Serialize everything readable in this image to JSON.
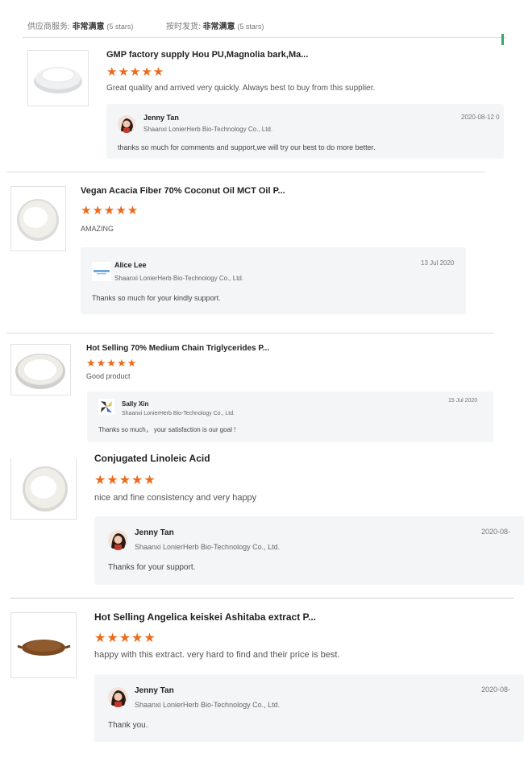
{
  "topbar": {
    "service_label": "供应商服务:",
    "service_value": "非常满意",
    "service_stars": "(5 stars)",
    "delivery_label": "按时发货:",
    "delivery_value": "非常满意",
    "delivery_stars": "(5 stars)"
  },
  "colors": {
    "star": "#ee6a1a",
    "reply_bg": "#f4f5f6",
    "divider": "#dcdcdc"
  },
  "reviews": [
    {
      "product_title": "GMP factory supply Hou PU,Magnolia bark,Ma...",
      "rating": 5,
      "stars": "★★★★★",
      "comment": "Great quality and arrived very quickly.  Always best to buy from this supplier.",
      "thumb_icon": "white-powder-dish-icon",
      "reply": {
        "name": "Jenny Tan",
        "company": "Shaanxi LonierHerb Bio-Technology Co., Ltd.",
        "date": "2020-08-12 0",
        "text": "thanks so much for comments and support,we will try our best to do more better.",
        "avatar_icon": "jenny-tan-avatar-icon"
      }
    },
    {
      "product_title": "Vegan Acacia Fiber 70% Coconut Oil MCT Oil P...",
      "rating": 5,
      "stars": "★★★★★",
      "comment": "AMAZING",
      "thumb_icon": "white-powder-dish-icon",
      "reply": {
        "name": "Alice Lee",
        "company": "Shaanxi LonierHerb Bio-Technology Co., Ltd.",
        "date": "13 Jul 2020",
        "text": "Thanks so much for your kindly support.",
        "avatar_icon": "company-logo-avatar-icon"
      }
    },
    {
      "product_title": "Hot Selling 70% Medium Chain Triglycerides P...",
      "rating": 5,
      "stars": "★★★★★",
      "comment": "Good product",
      "thumb_icon": "white-powder-dish-icon",
      "reply": {
        "name": "Sally Xin",
        "company": "Shaanxi LonierHerb Bio-Technology Co., Ltd.",
        "date": "15 Jul 2020",
        "text": "Thanks so much， your satisfaction is our goal !",
        "avatar_icon": "pinwheel-avatar-icon"
      }
    },
    {
      "product_title": "Conjugated Linoleic Acid",
      "rating": 5,
      "stars": "★★★★★",
      "comment": "nice and fine consistency and very happy",
      "thumb_icon": "white-powder-dish-icon",
      "reply": {
        "name": "Jenny Tan",
        "company": "Shaanxi LonierHerb Bio-Technology Co., Ltd.",
        "date": "2020-08-",
        "text": "Thanks for your support.",
        "avatar_icon": "jenny-tan-avatar-icon"
      }
    },
    {
      "product_title": "Hot Selling Angelica keiskei Ashitaba extract P...",
      "rating": 5,
      "stars": "★★★★★",
      "comment": "happy with this extract.  very hard to find and their price is best.",
      "thumb_icon": "brown-extract-dish-icon",
      "reply": {
        "name": "Jenny Tan",
        "company": "Shaanxi LonierHerb Bio-Technology Co., Ltd.",
        "date": "2020-08-",
        "text": "Thank you.",
        "avatar_icon": "jenny-tan-avatar-icon"
      }
    }
  ]
}
